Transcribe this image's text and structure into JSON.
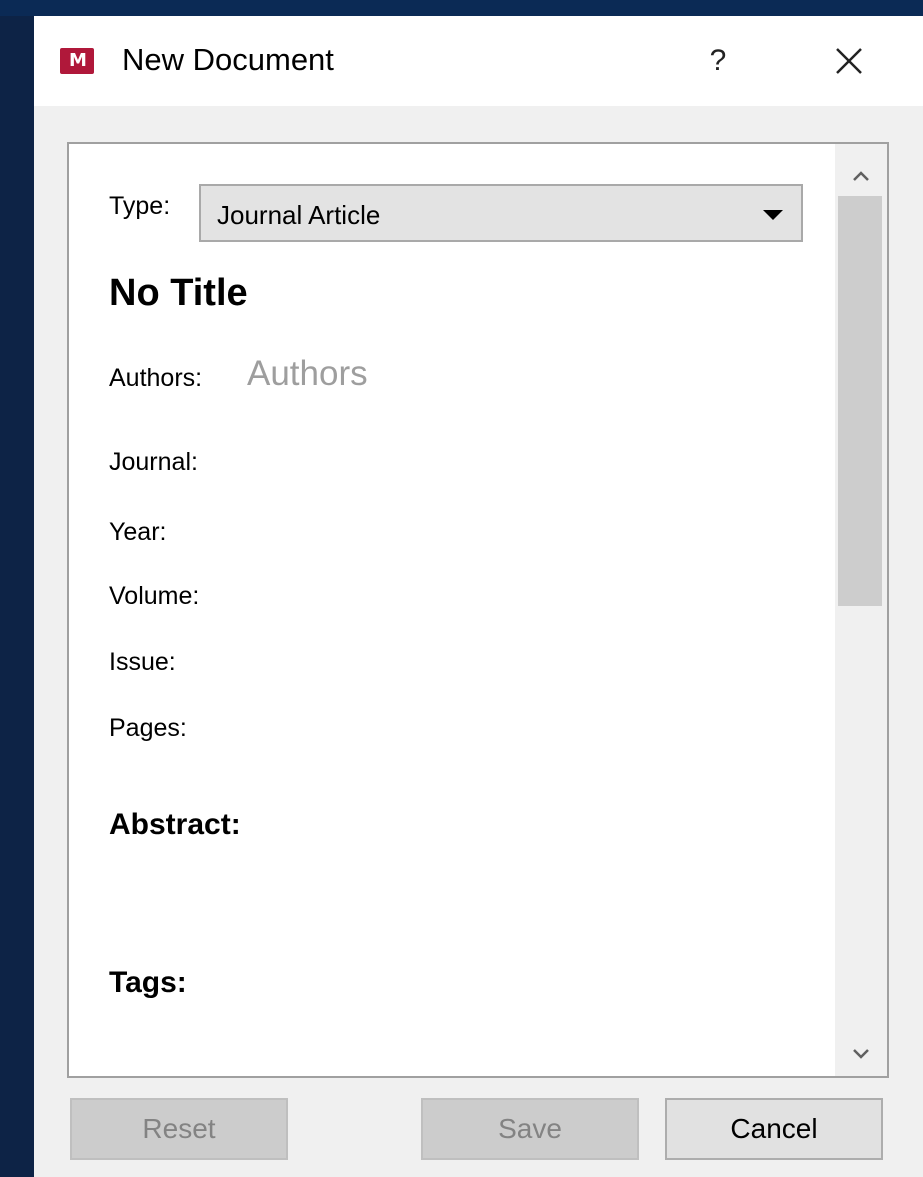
{
  "dialog": {
    "title": "New Document",
    "help_label": "?",
    "icons": {
      "app": "mendeley-logo-icon",
      "close": "close-icon"
    }
  },
  "form": {
    "type_label": "Type:",
    "type_value": "Journal Article",
    "doc_title": "No Title",
    "authors_label": "Authors:",
    "authors_placeholder": "Authors",
    "journal_label": "Journal:",
    "year_label": "Year:",
    "volume_label": "Volume:",
    "issue_label": "Issue:",
    "pages_label": "Pages:",
    "abstract_label": "Abstract:",
    "tags_label": "Tags:"
  },
  "buttons": {
    "reset": "Reset",
    "save": "Save",
    "cancel": "Cancel"
  },
  "colors": {
    "desktop": "#0d2346",
    "app_icon": "#b0183a",
    "placeholder": "#9e9e9e"
  }
}
